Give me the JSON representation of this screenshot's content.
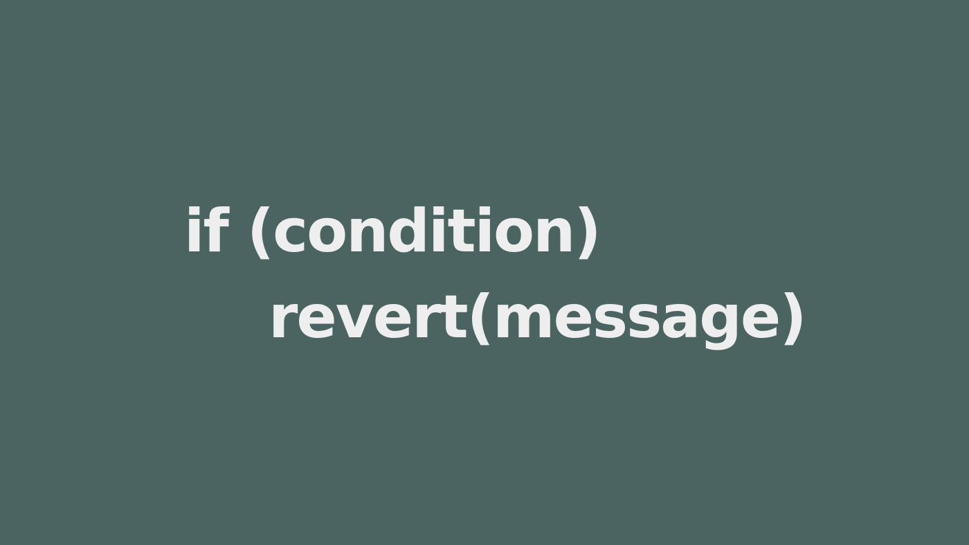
{
  "background_color": "#4b6462",
  "text_color": "#eeeeee",
  "code": {
    "line1": "if (condition)",
    "line2": "revert(message)"
  }
}
